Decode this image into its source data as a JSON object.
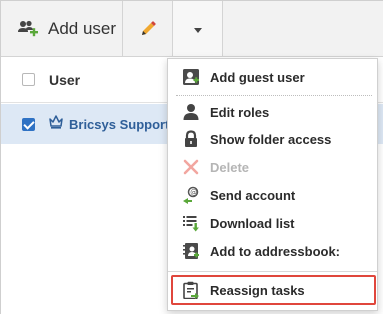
{
  "toolbar": {
    "add_user_label": "Add user",
    "icons": [
      "add-user-icon",
      "pencil-icon",
      "caret-down-icon"
    ]
  },
  "list": {
    "column_header": "User",
    "rows": [
      {
        "name": "Bricsys Support",
        "selected": true,
        "icon": "crown-icon"
      }
    ]
  },
  "menu": {
    "items": [
      {
        "label": "Add guest user",
        "icon": "guest-user-icon",
        "disabled": false
      },
      {
        "label": "Edit roles",
        "icon": "person-icon",
        "disabled": false
      },
      {
        "label": "Show folder access",
        "icon": "lock-icon",
        "disabled": false
      },
      {
        "label": "Delete",
        "icon": "x-icon",
        "disabled": true
      },
      {
        "label": "Send account",
        "icon": "send-account-icon",
        "disabled": false
      },
      {
        "label": "Download list",
        "icon": "download-list-icon",
        "disabled": false
      },
      {
        "label": "Add to addressbook:",
        "icon": "addressbook-icon",
        "disabled": false
      },
      {
        "label": "Reassign tasks",
        "icon": "reassign-tasks-icon",
        "disabled": false,
        "highlighted": true
      }
    ]
  },
  "colors": {
    "accent_green": "#5aa83a",
    "selected_row": "#dde8f5",
    "checkbox_blue": "#2f72c4",
    "highlight_red": "#e0463c",
    "disabled_x": "#f2a6a0"
  }
}
